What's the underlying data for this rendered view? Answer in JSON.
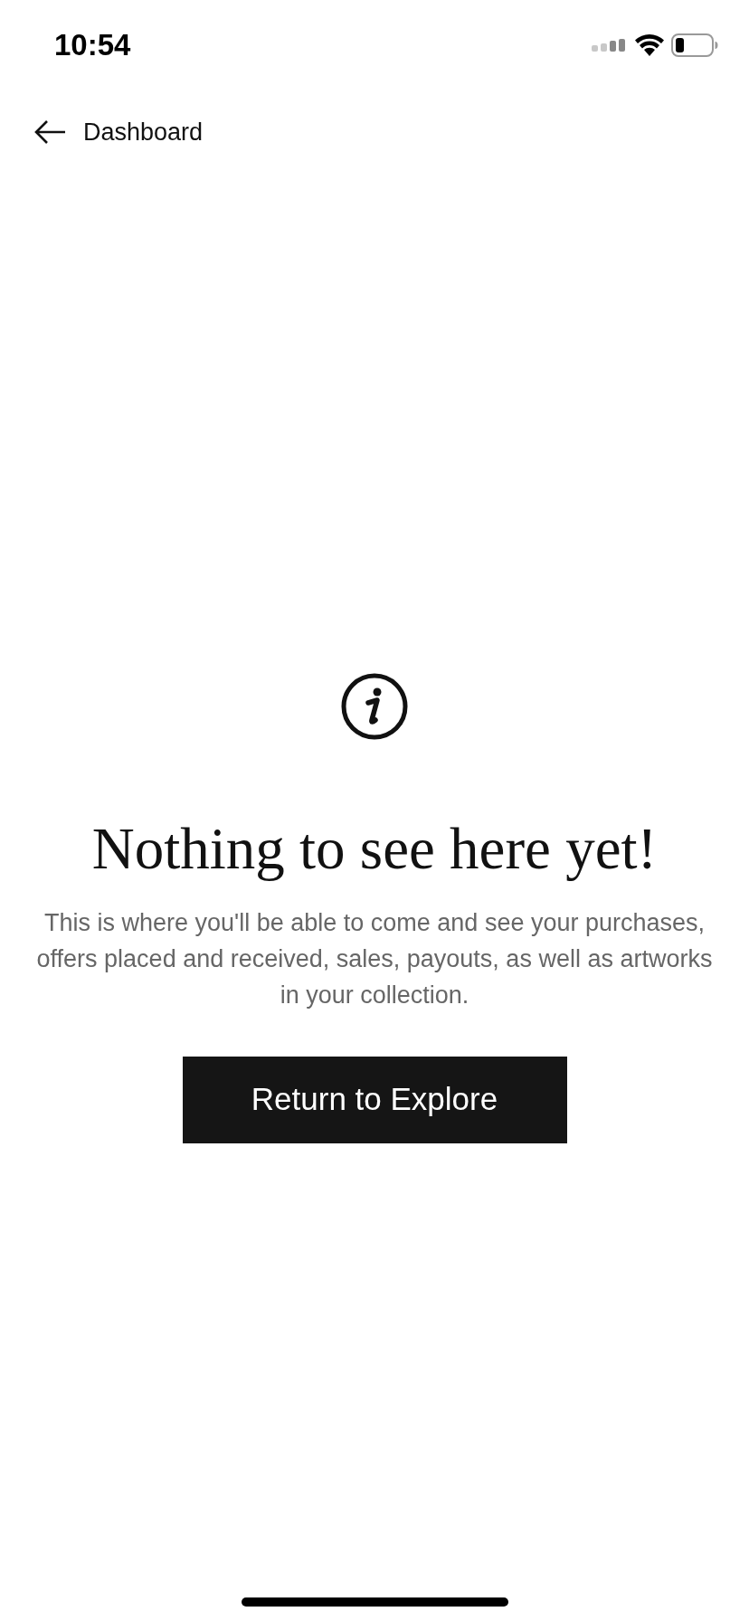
{
  "status_bar": {
    "time": "10:54"
  },
  "nav": {
    "back_label": "Dashboard"
  },
  "empty_state": {
    "title": "Nothing to see here yet!",
    "message": "This is where you'll be able to come and see your purchases, offers placed and received, sales, payouts, as well as artworks in your collection.",
    "button": "Return to Explore"
  }
}
